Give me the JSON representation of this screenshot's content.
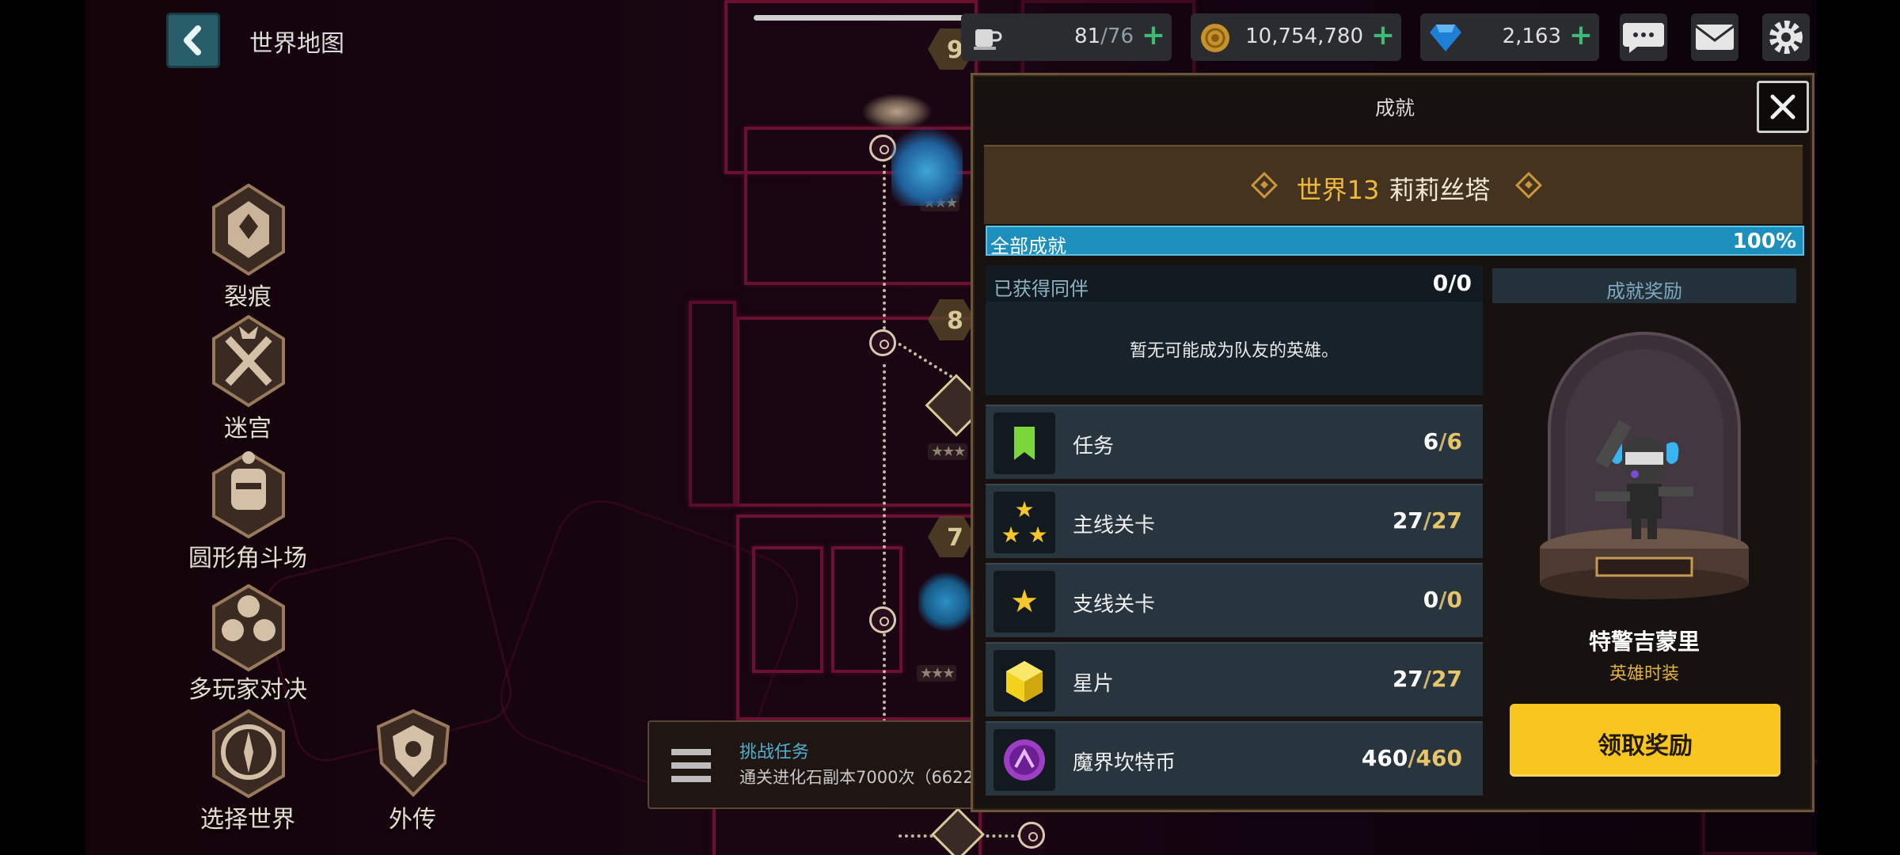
{
  "header": {
    "title": "世界地图"
  },
  "resources": {
    "stamina": {
      "current": "81",
      "max": "76"
    },
    "gold": "10,754,780",
    "gems": "2,163"
  },
  "left_menu": {
    "items": [
      {
        "label": "裂痕"
      },
      {
        "label": "迷宫"
      },
      {
        "label": "圆形角斗场"
      },
      {
        "label": "多玩家对决"
      },
      {
        "label": "选择世界"
      },
      {
        "label": "外传"
      }
    ]
  },
  "quest": {
    "title": "挑战任务",
    "description": "通关进化石副本7000次（6622"
  },
  "map": {
    "stage_numbers": [
      "9",
      "8",
      "7"
    ]
  },
  "dialog": {
    "title": "成就",
    "world": {
      "number": "世界13",
      "name": "莉莉丝塔"
    },
    "all_achievements": {
      "label": "全部成就",
      "percent": "100%",
      "progress": 1.0
    },
    "companion": {
      "title": "已获得同伴",
      "count": "0/0",
      "empty_text": "暂无可能成为队友的英雄。"
    },
    "rows": [
      {
        "icon": "bookmark-icon",
        "label": "任务",
        "done": "6",
        "total": "6"
      },
      {
        "icon": "three-stars-icon",
        "label": "主线关卡",
        "done": "27",
        "total": "27"
      },
      {
        "icon": "star-icon",
        "label": "支线关卡",
        "done": "0",
        "total": "0"
      },
      {
        "icon": "star-piece-cube-icon",
        "label": "星片",
        "done": "27",
        "total": "27"
      },
      {
        "icon": "magic-coin-icon",
        "label": "魔界坎特币",
        "done": "460",
        "total": "460"
      }
    ],
    "reward": {
      "title": "成就奖励",
      "costume_name": "特警吉蒙里",
      "costume_type": "英雄时装",
      "claim_label": "领取奖励"
    }
  },
  "colors": {
    "accent_yellow": "#f8c61f",
    "progress_blue": "#1d8fbd",
    "plus_green": "#3dbb72",
    "gold_text": "#e6c56a"
  }
}
